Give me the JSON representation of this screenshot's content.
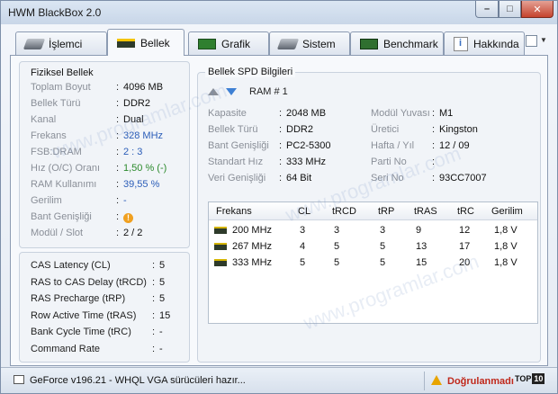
{
  "window": {
    "title": "HWM BlackBox 2.0",
    "min": "–",
    "max": "□",
    "close": "✕"
  },
  "tabs": [
    {
      "label": "İşlemci",
      "icon": "cpu-icon"
    },
    {
      "label": "Bellek",
      "icon": "memory-icon",
      "active": true
    },
    {
      "label": "Grafik",
      "icon": "gpu-icon"
    },
    {
      "label": "Sistem",
      "icon": "system-icon"
    },
    {
      "label": "Benchmark",
      "icon": "benchmark-icon"
    },
    {
      "label": "Hakkında",
      "icon": "info-icon"
    }
  ],
  "physical": {
    "title": "Fiziksel Bellek",
    "rows": [
      {
        "label": "Toplam Boyut",
        "value": "4096 MB"
      },
      {
        "label": "Bellek Türü",
        "value": "DDR2"
      },
      {
        "label": "Kanal",
        "value": "Dual"
      },
      {
        "label": "Frekans",
        "value": "328 MHz",
        "color": "blue"
      },
      {
        "label": "FSB:DRAM",
        "value": "2 : 3",
        "color": "blue"
      },
      {
        "label": "Hız (O/C) Oranı",
        "value": "1,50 % (-)",
        "color": "green"
      },
      {
        "label": "RAM Kullanımı",
        "value": "39,55 %",
        "color": "blue"
      },
      {
        "label": "Gerilim",
        "value": "-",
        "color": "blue"
      },
      {
        "label": "Bant Genişliği",
        "value": ""
      },
      {
        "label": "Modül / Slot",
        "value": "2  /  2"
      }
    ]
  },
  "timings": {
    "rows": [
      {
        "label": "CAS Latency (CL)",
        "value": "5"
      },
      {
        "label": "RAS to CAS Delay (tRCD)",
        "value": "5"
      },
      {
        "label": "RAS Precharge (tRP)",
        "value": "5"
      },
      {
        "label": "Row Active Time (tRAS)",
        "value": "15"
      },
      {
        "label": "Bank Cycle Time (tRC)",
        "value": "-"
      },
      {
        "label": "Command Rate",
        "value": "-"
      }
    ]
  },
  "spd": {
    "title": "Bellek SPD Bilgileri",
    "selector": "RAM # 1",
    "left": [
      {
        "label": "Kapasite",
        "value": "2048 MB"
      },
      {
        "label": "Bellek Türü",
        "value": "DDR2"
      },
      {
        "label": "Bant Genişliği",
        "value": "PC2-5300"
      },
      {
        "label": "Standart Hız",
        "value": "333 MHz"
      },
      {
        "label": "Veri Genişliği",
        "value": "64 Bit"
      }
    ],
    "right": [
      {
        "label": "Modül Yuvası",
        "value": "M1"
      },
      {
        "label": "Üretici",
        "value": "Kingston"
      },
      {
        "label": "Hafta / Yıl",
        "value": "12 / 09"
      },
      {
        "label": "Parti No",
        "value": ""
      },
      {
        "label": "Seri No",
        "value": "93CC7007"
      }
    ],
    "table": {
      "headers": [
        "Frekans",
        "CL",
        "tRCD",
        "tRP",
        "tRAS",
        "tRC",
        "Gerilim"
      ],
      "rows": [
        [
          "200 MHz",
          "3",
          "3",
          "3",
          "9",
          "12",
          "1,8 V"
        ],
        [
          "267 MHz",
          "4",
          "5",
          "5",
          "13",
          "17",
          "1,8 V"
        ],
        [
          "333 MHz",
          "5",
          "5",
          "5",
          "15",
          "20",
          "1,8 V"
        ]
      ]
    }
  },
  "status": {
    "left": "GeForce v196.21 - WHQL VGA sürücüleri hazır...",
    "right": "Doğrulanmadı",
    "logo_a": "TOP",
    "logo_b": "10"
  },
  "watermark_text": "www.programlar.com"
}
